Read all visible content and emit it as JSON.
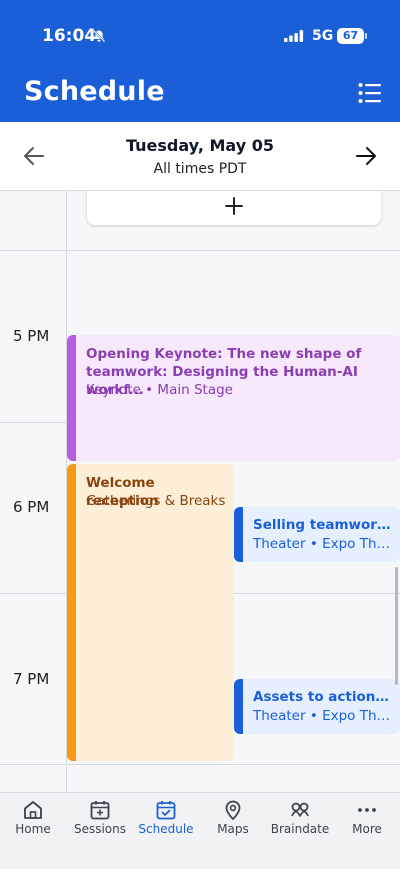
{
  "status_bar": {
    "time": "16:04",
    "network": "5G",
    "battery": "67"
  },
  "header": {
    "title": "Schedule"
  },
  "date_bar": {
    "date": "Tuesday, May 05",
    "timezone": "All times PDT"
  },
  "schedule": {
    "hours": [
      "5 PM",
      "6 PM",
      "7 PM"
    ],
    "events": [
      {
        "title": "Opening Keynote: The new shape of teamwork: Designing the Human-AI workf...",
        "meta": "Keynote • Main Stage",
        "color": "#b45fe0"
      },
      {
        "title": "Welcome reception",
        "meta": "Gatherings & Breaks",
        "color": "#f59a14"
      },
      {
        "title": "Selling teamwork:...",
        "meta": "Theater • Expo The...",
        "color": "#1a5fd8"
      },
      {
        "title": "Assets to action: A...",
        "meta": "Theater • Expo The...",
        "color": "#1a5fd8"
      }
    ]
  },
  "tabs": [
    {
      "label": "Home",
      "icon": "home-icon"
    },
    {
      "label": "Sessions",
      "icon": "calendar-plus-icon"
    },
    {
      "label": "Schedule",
      "icon": "calendar-check-icon",
      "active": true
    },
    {
      "label": "Maps",
      "icon": "map-pin-icon"
    },
    {
      "label": "Braindate",
      "icon": "braindate-icon"
    },
    {
      "label": "More",
      "icon": "more-dots-icon"
    }
  ],
  "colors": {
    "brand": "#1a5fd8",
    "keynote": "#b45fe0",
    "reception": "#f59a14",
    "theater": "#1a5fd8"
  }
}
